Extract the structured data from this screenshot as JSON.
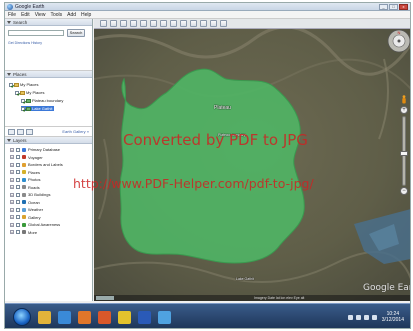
{
  "window": {
    "title": "Google Earth",
    "controls": [
      "_",
      "□",
      "x"
    ]
  },
  "menubar": {
    "items": [
      "File",
      "Edit",
      "View",
      "Tools",
      "Add",
      "Help"
    ]
  },
  "sidebar": {
    "search": {
      "header": "Search",
      "button_label": "Search",
      "links": "Get Directions   History"
    },
    "places": {
      "header": "Places",
      "items": [
        {
          "label": "My Places",
          "checked": true,
          "icon": "folder-icon"
        },
        {
          "label": "My Places",
          "checked": true,
          "icon": "folder-icon"
        },
        {
          "label": "Plateau boundary",
          "checked": true,
          "icon": "polygon-icon"
        },
        {
          "label": "Lake Gathit",
          "checked": true,
          "icon": "polygon-icon",
          "selected": true
        }
      ]
    },
    "nav": {
      "link": "Earth Gallery »"
    },
    "layers": {
      "header": "Layers",
      "items": [
        {
          "label": "Primary Database",
          "icon": "globe-icon",
          "color": "#3b78d8"
        },
        {
          "label": "Voyager",
          "icon": "compass-icon",
          "color": "#c0392b"
        },
        {
          "label": "Borders and Labels",
          "icon": "border-icon",
          "color": "#e0a030"
        },
        {
          "label": "Places",
          "icon": "pin-icon",
          "color": "#d4b12a"
        },
        {
          "label": "Photos",
          "icon": "photo-icon",
          "color": "#2f8fcf"
        },
        {
          "label": "Roads",
          "icon": "road-icon",
          "color": "#888888"
        },
        {
          "label": "3D Buildings",
          "icon": "building-icon",
          "color": "#8a8a8a"
        },
        {
          "label": "Ocean",
          "icon": "ocean-icon",
          "color": "#1f6fb2"
        },
        {
          "label": "Weather",
          "icon": "weather-icon",
          "color": "#5ca0d8"
        },
        {
          "label": "Gallery",
          "icon": "gallery-icon",
          "color": "#d9a22e"
        },
        {
          "label": "Global Awareness",
          "icon": "awareness-icon",
          "color": "#3a9a3a"
        },
        {
          "label": "More",
          "icon": "more-icon",
          "color": "#777777"
        }
      ]
    }
  },
  "map": {
    "labels": {
      "polygon_label": "Plateau",
      "north_label": "Plateau boundary",
      "south_label": "Lake Gathit"
    },
    "watermark_1": "Converted by PDF to JPG",
    "watermark_2": "http://www.PDF-Helper.com/pdf-to-jpg/",
    "logo": "Google Earth",
    "status": "Imagery Date   lat   lon   elev   Eye alt",
    "colors": {
      "polygon_fill": "#4fb765",
      "terrain": "#6f6a55",
      "water": "#4a6f8a"
    }
  },
  "taskbar": {
    "clock_time": "10:24",
    "clock_date": "3/12/2014",
    "apps": [
      {
        "name": "explorer-icon",
        "color": "#e2b33a"
      },
      {
        "name": "ie-icon",
        "color": "#3a8ad8"
      },
      {
        "name": "media-icon",
        "color": "#e0762a"
      },
      {
        "name": "firefox-icon",
        "color": "#d9582a"
      },
      {
        "name": "chrome-icon",
        "color": "#e3c22d"
      },
      {
        "name": "word-icon",
        "color": "#2a5ab8"
      },
      {
        "name": "earth-icon",
        "color": "#4fa2e0"
      }
    ]
  }
}
